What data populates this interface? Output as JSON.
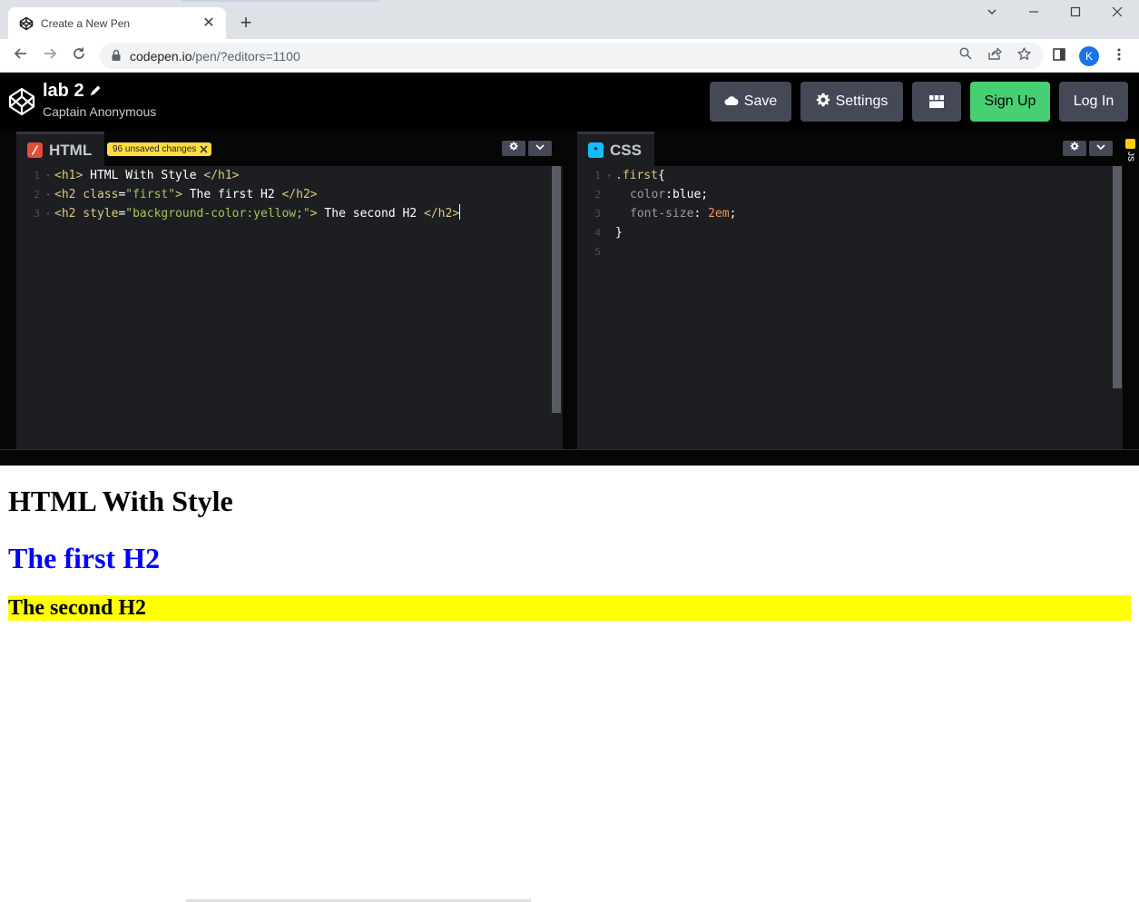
{
  "browser": {
    "tab_title": "Create a New Pen",
    "tab_close": "✕",
    "new_tab": "+",
    "url_host": "codepen.io",
    "url_path": "/pen/?editors=1100",
    "profile_initial": "K",
    "icons": {
      "back": "arrow-left-icon",
      "forward": "arrow-right-icon",
      "reload": "reload-icon",
      "search": "search-icon",
      "share": "share-icon",
      "bookmark": "star-icon",
      "sidepanel": "side-panel-icon",
      "menu": "kebab-menu-icon"
    }
  },
  "header": {
    "pen_title": "lab 2",
    "author": "Captain Anonymous",
    "buttons": {
      "save": "Save",
      "settings": "Settings",
      "signup": "Sign Up",
      "login": "Log In"
    },
    "colors": {
      "signup": "#47cf73",
      "button": "#444857"
    }
  },
  "editors": {
    "html": {
      "label": "HTML",
      "badge": "96 unsaved changes",
      "line_numbers": [
        "1",
        "2",
        "3"
      ],
      "lines": [
        {
          "open": "<h1>",
          "text": " HTML With Style ",
          "close": "</h1>"
        },
        {
          "open": "<h2",
          "attr": " class",
          "eq": "=",
          "str": "\"first\"",
          "end": ">",
          "text": " The first H2 ",
          "close": "</h2>"
        },
        {
          "open": "<h2",
          "attr": " style",
          "eq": "=",
          "str": "\"background-color:yellow;\"",
          "end": ">",
          "text": " The second H2 ",
          "close": "</h2>"
        }
      ]
    },
    "css": {
      "label": "CSS",
      "line_numbers": [
        "1",
        "2",
        "3",
        "4",
        "5"
      ],
      "lines": [
        {
          "selector": ".first",
          "brace": "{"
        },
        {
          "prop": "color",
          "colon": ":",
          "value": "blue",
          "semi": ";"
        },
        {
          "prop": "font-size",
          "colon": ": ",
          "value": "2em",
          "semi": ";"
        },
        {
          "brace": "}"
        }
      ]
    },
    "js": {
      "label": "JS"
    }
  },
  "preview": {
    "h1": "HTML With Style",
    "h2_first": "The first H2",
    "h2_second": "The second H2"
  }
}
